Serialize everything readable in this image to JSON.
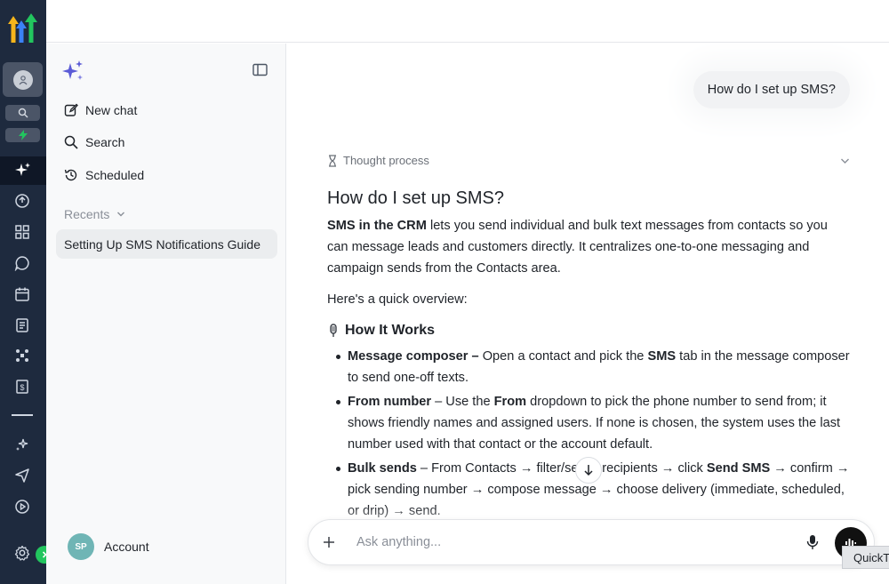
{
  "sidebar": {
    "new_chat": "New chat",
    "search": "Search",
    "scheduled": "Scheduled",
    "recents_label": "Recents",
    "chats": [
      "Setting Up SMS Notifications Guide"
    ],
    "account_initials": "SP",
    "account_label": "Account"
  },
  "main": {
    "user_message": "How do I set up SMS?",
    "thought_label": "Thought process",
    "heading": "How do I set up SMS?",
    "intro_bold": "SMS in the CRM",
    "intro_rest": " lets you send individual and bulk text messages from contacts so you can message leads and customers directly. It centralizes one-to-one messaging and campaign sends from the Contacts area.",
    "overview": "Here's a quick overview:",
    "section_title": "How It Works",
    "bullets": [
      {
        "b1": "Message composer –",
        "t1": " Open a contact and pick the ",
        "b2": "SMS",
        "t2": " tab in the message composer to send one-off texts."
      },
      {
        "b1": "From number",
        "t1": " – Use the ",
        "b2": "From",
        "t2": " dropdown to pick the phone number to send from; it shows friendly names and assigned users. If none is chosen, the system uses the last number used with that contact or the account default."
      },
      {
        "b1": "Bulk sends",
        "t1": " – From Contacts → filter/select recipients → click ",
        "b2": "Send SMS",
        "t2": " → confirm → pick sending number → compose message → choose delivery (immediate, scheduled, or drip) → send."
      }
    ]
  },
  "input": {
    "placeholder": "Ask anything..."
  },
  "tooltip": "QuickT",
  "colors": {
    "rail": "#1e2a3e",
    "sidebar": "#f8f9fa",
    "accent": "#5b5bd6"
  },
  "rail_icons": [
    "logo-icon",
    "account-icon",
    "search-icon",
    "lightning-icon",
    "ai-sparkle-icon",
    "launchpad-icon",
    "dashboard-icon",
    "conversations-icon",
    "calendar-icon",
    "contacts-icon",
    "opportunities-icon",
    "payments-icon",
    "ai-agents-icon",
    "marketing-icon",
    "automation-icon",
    "settings-icon"
  ]
}
